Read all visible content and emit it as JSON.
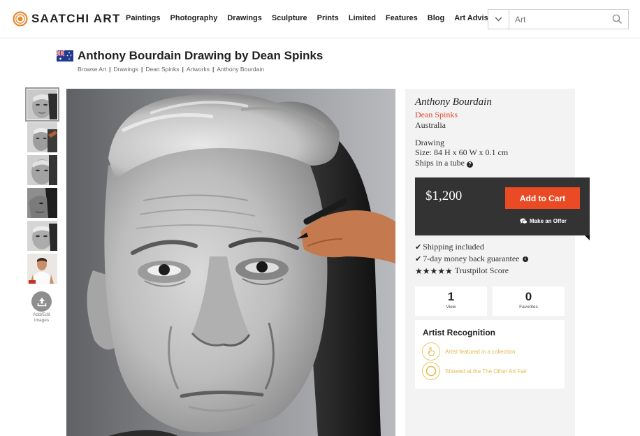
{
  "header": {
    "logo_text": "SAATCHI ART",
    "nav": [
      "Paintings",
      "Photography",
      "Drawings",
      "Sculpture",
      "Prints",
      "Limited",
      "Features",
      "Blog",
      "Art Advisory"
    ],
    "search": {
      "value": "Art"
    }
  },
  "artwork": {
    "title": "Anthony Bourdain Drawing by Dean Spinks",
    "breadcrumbs": [
      "Browse Art",
      "Drawings",
      "Dean Spinks",
      "Artworks",
      "Anthony Bourdain"
    ]
  },
  "gallery": {
    "upload_label": "Add/Edit Images"
  },
  "details": {
    "artwork_name": "Anthony Bourdain",
    "artist": "Dean Spinks",
    "country": "Australia",
    "medium": "Drawing",
    "size": "Size: 84 H x 60 W x 0.1 cm",
    "shipping_method": "Ships in a tube"
  },
  "purchase": {
    "price": "$1,200",
    "cart_label": "Add to Cart",
    "offer_label": "Make an Offer"
  },
  "features": {
    "shipping": "Shipping included",
    "guarantee": "7-day money back guarantee",
    "trustpilot": "Trustpilot Score"
  },
  "stats": {
    "views": {
      "value": "1",
      "label": "View"
    },
    "favorites": {
      "value": "0",
      "label": "Favorites"
    }
  },
  "recognition": {
    "title": "Artist Recognition",
    "items": [
      "Artist featured in a collection",
      "Showed at the The Other Art Fair"
    ]
  },
  "colors": {
    "accent": "#ea4b25",
    "artist_link": "#e0452e",
    "price_box": "#333333",
    "recognition_gold": "#e3b94f",
    "logo_orange": "#e8862a"
  },
  "icons": [
    "saatchi-logo-icon",
    "chevron-down-icon",
    "search-icon",
    "australia-flag-icon",
    "upload-icon",
    "help-icon",
    "chat-icon",
    "check-icon",
    "info-icon",
    "star-icon",
    "hand-pointer-icon",
    "ring-icon"
  ]
}
